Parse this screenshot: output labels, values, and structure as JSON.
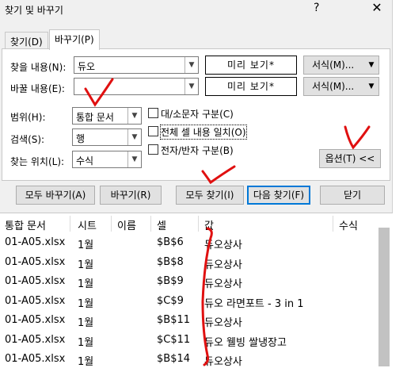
{
  "window": {
    "title": "찾기 및 바꾸기",
    "help": "?",
    "close": "✕"
  },
  "tabs": [
    {
      "label": "찾기(D)"
    },
    {
      "label": "바꾸기(P)"
    }
  ],
  "find": {
    "label": "찾을 내용(N):",
    "value": "듀오",
    "preview": "미리 보기*",
    "format_label": "서식(M)..."
  },
  "replace": {
    "label": "바꿀 내용(E):",
    "value": "",
    "preview": "미리 보기*",
    "format_label": "서식(M)..."
  },
  "options": {
    "scope": {
      "label": "범위(H):",
      "value": "통합 문서"
    },
    "search": {
      "label": "검색(S):",
      "value": "행"
    },
    "look_in": {
      "label": "찾는 위치(L):",
      "value": "수식"
    },
    "match_case": {
      "label": "대/소문자 구분(C)",
      "checked": false
    },
    "match_entire": {
      "label": "전체 셀 내용 일치(O)",
      "checked": false
    },
    "match_width": {
      "label": "전자/반자 구분(B)",
      "checked": false
    },
    "toggle_label": "옵션(T) <<"
  },
  "actions": {
    "replace_all": "모두 바꾸기(A)",
    "replace": "바꾸기(R)",
    "find_all": "모두 찾기(I)",
    "find_next": "다음 찾기(F)",
    "close": "닫기"
  },
  "results": {
    "columns": [
      "통합 문서",
      "시트",
      "이름",
      "셀",
      "값",
      "수식"
    ],
    "rows": [
      {
        "workbook": "01-A05.xlsx",
        "sheet": "1월",
        "name": "",
        "cell": "$B$6",
        "value": "듀오상사",
        "formula": ""
      },
      {
        "workbook": "01-A05.xlsx",
        "sheet": "1월",
        "name": "",
        "cell": "$B$8",
        "value": "듀오상사",
        "formula": ""
      },
      {
        "workbook": "01-A05.xlsx",
        "sheet": "1월",
        "name": "",
        "cell": "$B$9",
        "value": "듀오상사",
        "formula": ""
      },
      {
        "workbook": "01-A05.xlsx",
        "sheet": "1월",
        "name": "",
        "cell": "$C$9",
        "value": "듀오 라면포트 - 3 in 1",
        "formula": ""
      },
      {
        "workbook": "01-A05.xlsx",
        "sheet": "1월",
        "name": "",
        "cell": "$B$11",
        "value": "듀오상사",
        "formula": ""
      },
      {
        "workbook": "01-A05.xlsx",
        "sheet": "1월",
        "name": "",
        "cell": "$C$11",
        "value": "듀오 웰빙 쌀냉장고",
        "formula": ""
      },
      {
        "workbook": "01-A05.xlsx",
        "sheet": "1월",
        "name": "",
        "cell": "$B$14",
        "value": "듀오상사",
        "formula": ""
      }
    ]
  },
  "colors": {
    "annotation": "#e01010",
    "dialog_bg": "#f0f0f0",
    "focus": "#0078d7"
  }
}
